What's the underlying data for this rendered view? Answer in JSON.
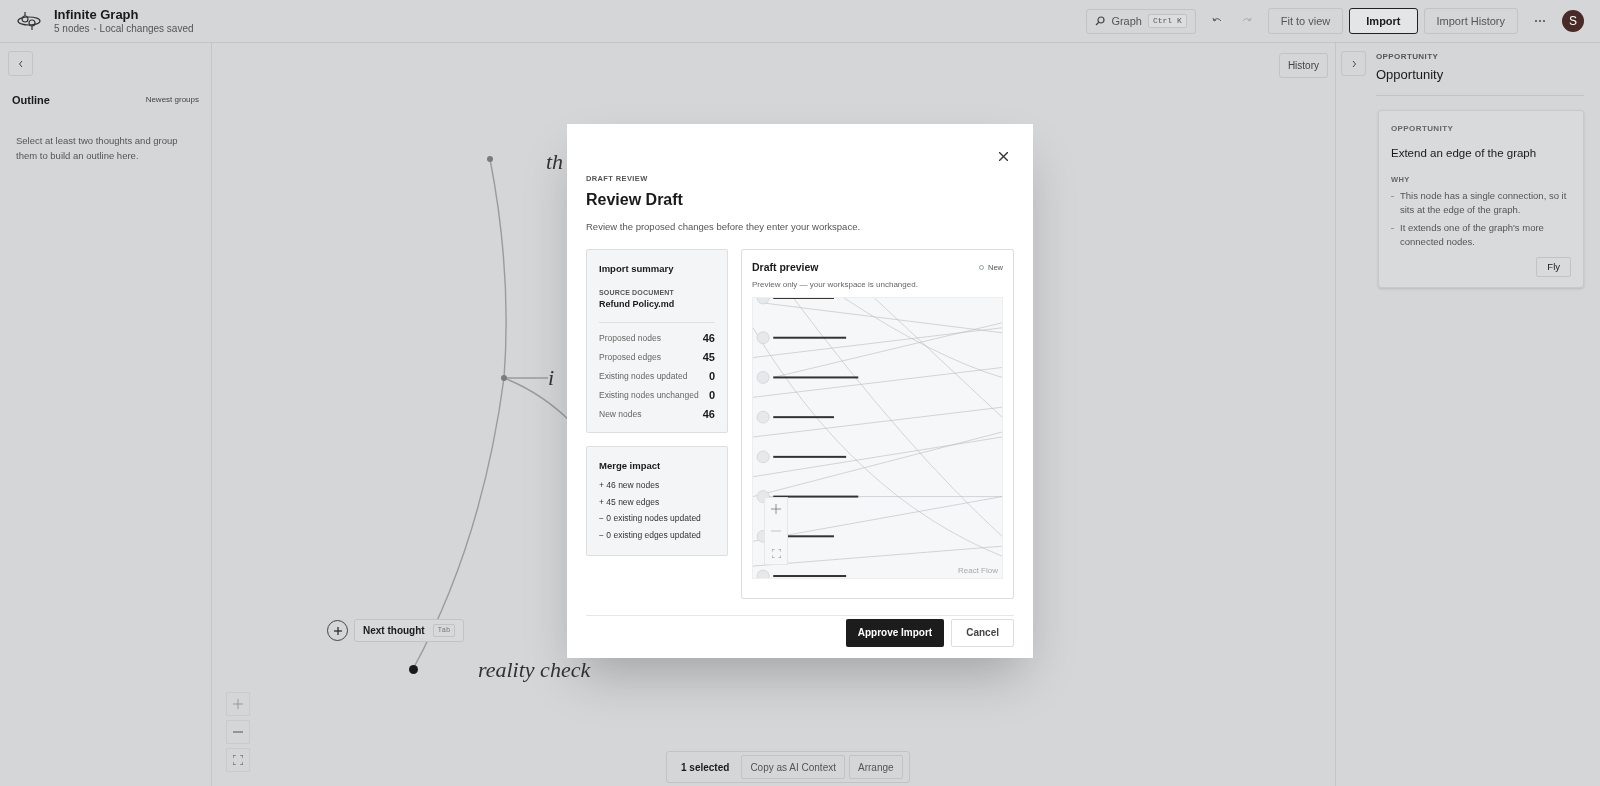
{
  "app": {
    "title": "Infinite Graph",
    "node_count": "5 nodes",
    "save_status": "Local changes saved"
  },
  "toolbar": {
    "search": {
      "label": "Graph",
      "shortcut": "Ctrl K"
    },
    "buttons": [
      {
        "label": "Fit to view",
        "selected": false
      },
      {
        "label": "Import",
        "selected": true
      },
      {
        "label": "Import History",
        "selected": false
      }
    ],
    "avatar": "S"
  },
  "outline": {
    "title": "Outline",
    "sort": "Newest groups",
    "empty_text": "Select at least two thoughts and group them to build an outline here."
  },
  "canvas": {
    "history_button": "History",
    "nodes": [
      {
        "label": "th",
        "selected": false
      },
      {
        "label": "i",
        "selected": false
      },
      {
        "label": "reality check",
        "selected": true
      }
    ],
    "next_thought": {
      "label": "Next thought",
      "shortcut": "Tab"
    },
    "selection_bar": {
      "count": "1 selected",
      "buttons": [
        "Copy as AI Context",
        "Arrange"
      ]
    }
  },
  "right_panel": {
    "eyebrow": "OPPORTUNITY",
    "title": "Opportunity",
    "card": {
      "eyebrow": "OPPORTUNITY",
      "title": "Extend an edge of the graph",
      "why_label": "WHY",
      "reasons": [
        "This node has a single connection, so it sits at the edge of the graph.",
        "It extends one of the graph's more connected nodes."
      ],
      "button": "Fly"
    }
  },
  "dialog": {
    "eyebrow": "DRAFT REVIEW",
    "title": "Review Draft",
    "description": "Review the proposed changes before they enter your workspace.",
    "summary": {
      "title": "Import summary",
      "source_label": "SOURCE DOCUMENT",
      "source": "Refund Policy.md",
      "stats": [
        {
          "label": "Proposed nodes",
          "value": "46"
        },
        {
          "label": "Proposed edges",
          "value": "45"
        },
        {
          "label": "Existing nodes updated",
          "value": "0"
        },
        {
          "label": "Existing nodes unchanged",
          "value": "0"
        },
        {
          "label": "New nodes",
          "value": "46"
        }
      ]
    },
    "merge": {
      "title": "Merge impact",
      "lines": [
        "+ 46 new nodes",
        "+ 45 new edges",
        "− 0 existing nodes updated",
        "− 0 existing edges updated"
      ]
    },
    "preview": {
      "title": "Draft preview",
      "legend": "New",
      "note": "Preview only — your workspace is unchanged.",
      "attribution": "React Flow"
    },
    "approve": "Approve Import",
    "cancel": "Cancel"
  }
}
